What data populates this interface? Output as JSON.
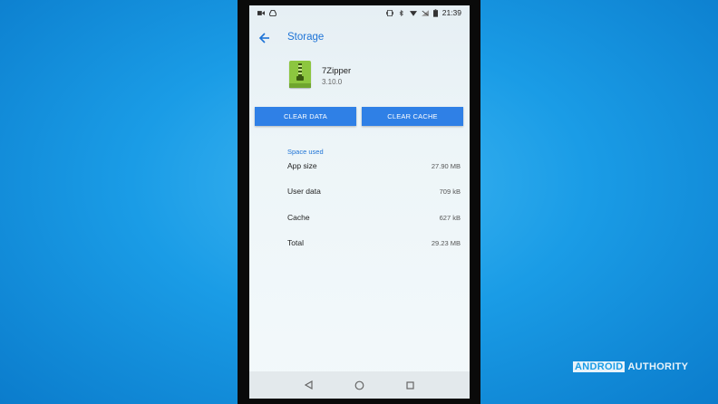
{
  "status_bar": {
    "time": "21:39"
  },
  "header": {
    "title": "Storage"
  },
  "app": {
    "name": "7Zipper",
    "version": "3.10.0"
  },
  "buttons": {
    "clear_data": "CLEAR DATA",
    "clear_cache": "CLEAR CACHE"
  },
  "space_used": {
    "label": "Space used",
    "rows": [
      {
        "label": "App size",
        "value": "27.90 MB"
      },
      {
        "label": "User data",
        "value": "709 kB"
      },
      {
        "label": "Cache",
        "value": "627 kB"
      },
      {
        "label": "Total",
        "value": "29.23 MB"
      }
    ]
  },
  "watermark": {
    "part1": "ANDROID",
    "part2": "AUTHORITY"
  },
  "colors": {
    "accent": "#1e73d6",
    "button": "#2f80e6",
    "app_icon": "#8cc63f",
    "background": "#1a9ce6"
  }
}
